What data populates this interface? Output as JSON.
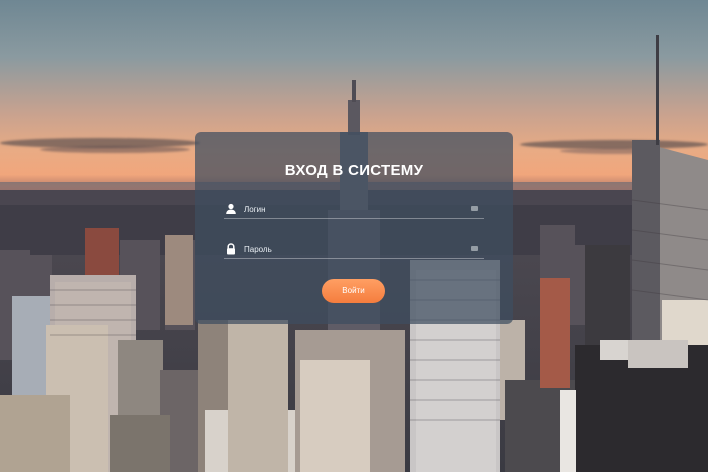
{
  "login_form": {
    "title": "ВХОД В СИСТЕМУ",
    "login_placeholder": "Логин",
    "password_placeholder": "Пароль",
    "submit_label": "Войти",
    "login_icon": "user-icon",
    "password_icon": "lock-icon",
    "field_side_icon": "keyboard-icon"
  },
  "colors": {
    "panel": "#3e4e60",
    "button_top": "#ff9f63",
    "button_bottom": "#f57d3e",
    "text": "#ffffff"
  }
}
